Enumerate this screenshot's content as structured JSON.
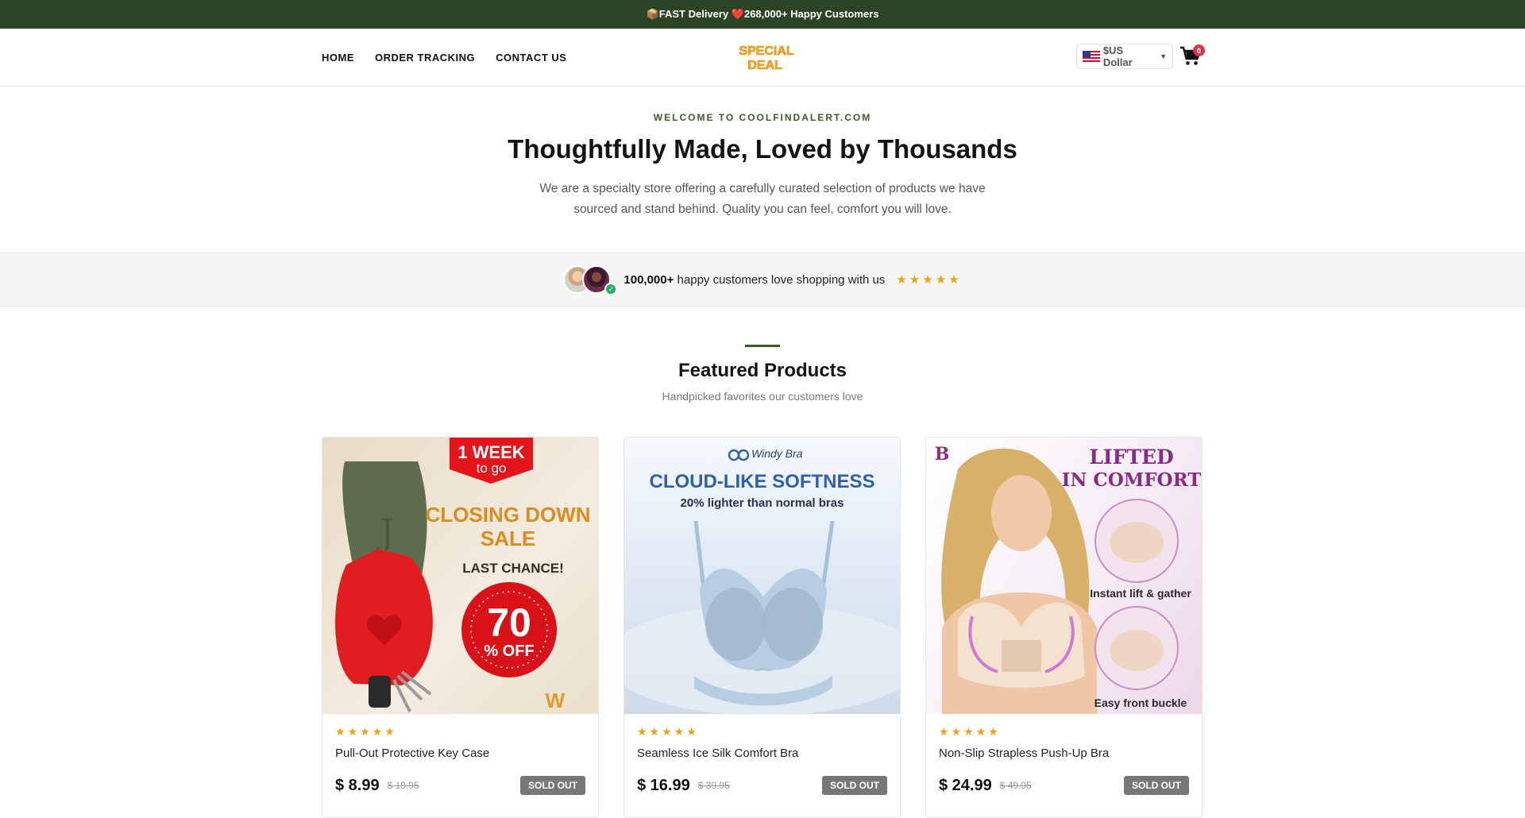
{
  "announcement": {
    "text": "📦FAST Delivery ❤️268,000+ Happy Customers"
  },
  "nav": {
    "items": [
      "HOME",
      "ORDER TRACKING",
      "CONTACT US"
    ]
  },
  "logo": {
    "line1": "SPECIAL",
    "line2": "DEAL"
  },
  "currency": {
    "label": "$US Dollar"
  },
  "cart": {
    "count": "0"
  },
  "welcome": {
    "kicker": "WELCOME TO COOLFINDALERT.COM",
    "title": "Thoughtfully Made, Loved by Thousands",
    "description": "We are a specialty store offering a carefully curated selection of products we have sourced and stand behind. Quality you can feel, comfort you will love."
  },
  "proof": {
    "count": "100,000+",
    "text": " happy customers love shopping with us",
    "stars": "★★★★★"
  },
  "featured": {
    "title": "Featured Products",
    "subtitle": "Handpicked favorites our customers love"
  },
  "products": [
    {
      "name": "Pull-Out Protective Key Case",
      "stars": "★★★★★",
      "price": "$ 8.99",
      "old_price": "$ 19.95",
      "badge": "SOLD OUT",
      "image_text": {
        "banner1": "1 WEEK",
        "banner2": "to go",
        "sale1": "CLOSING DOWN",
        "sale2": "SALE",
        "chance": "LAST CHANCE!",
        "pct": "70",
        "off": "% OFF",
        "monogram": "J"
      }
    },
    {
      "name": "Seamless Ice Silk Comfort Bra",
      "stars": "★★★★★",
      "price": "$ 16.99",
      "old_price": "$ 39.95",
      "badge": "SOLD OUT",
      "image_text": {
        "brand": "Windy Bra",
        "headline": "CLOUD-LIKE SOFTNESS",
        "sub": "20% lighter than normal bras"
      }
    },
    {
      "name": "Non-Slip Strapless Push-Up Bra",
      "stars": "★★★★★",
      "price": "$ 24.99",
      "old_price": "$ 49.95",
      "badge": "SOLD OUT",
      "image_text": {
        "logo": "B",
        "headline1": "LIFTED",
        "headline2": "IN COMFORT",
        "feature1": "Instant lift & gather",
        "feature2": "Easy front buckle"
      }
    }
  ],
  "colors": {
    "brand_green": "#2c4425",
    "accent_green": "#3b5b2e",
    "star": "#e8a413",
    "badge_red": "#d8344b"
  }
}
